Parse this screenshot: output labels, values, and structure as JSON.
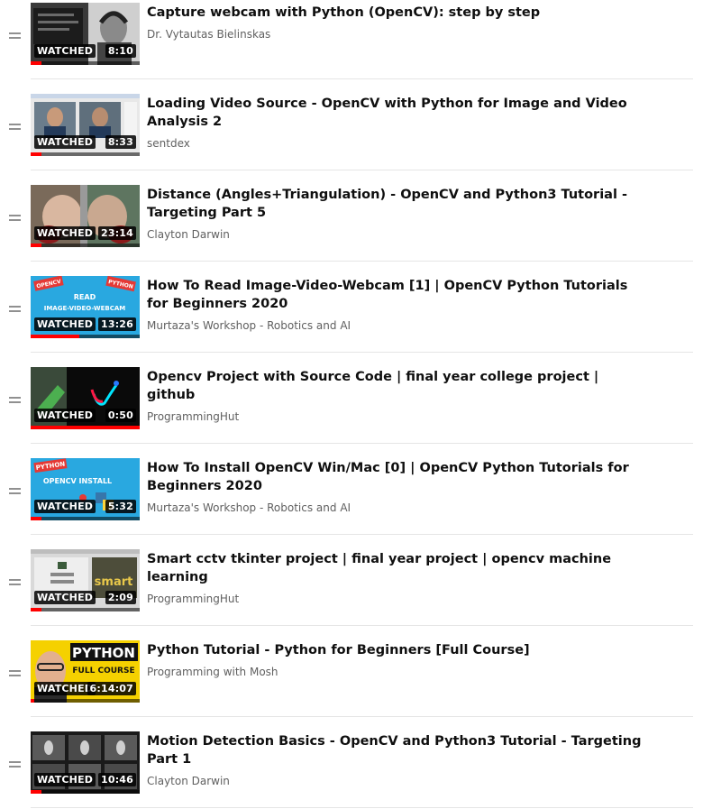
{
  "watched_label": "WATCHED",
  "progress_color": "#ff0000",
  "videos": [
    {
      "title": "Capture webcam with Python (OpenCV): step by step",
      "channel": "Dr. Vytautas Bielinskas",
      "duration": "8:10",
      "progress_fraction": 0.1,
      "thumb_style": "webcam-talk"
    },
    {
      "title": "Loading Video Source - OpenCV with Python for Image and Video Analysis 2",
      "channel": "sentdex",
      "duration": "8:33",
      "progress_fraction": 0.1,
      "thumb_style": "desktop-screens"
    },
    {
      "title": "Distance (Angles+Triangulation) - OpenCV and Python3 Tutorial - Targeting Part 5",
      "channel": "Clayton Darwin",
      "duration": "23:14",
      "progress_fraction": 0.1,
      "thumb_style": "hand-camera"
    },
    {
      "title": "How To Read Image-Video-Webcam [1] | OpenCV Python Tutorials for Beginners 2020",
      "channel": "Murtaza's Workshop - Robotics and AI",
      "duration": "13:26",
      "progress_fraction": 0.45,
      "thumb_style": "blue-tutorial-read",
      "thumb_text": [
        "OPENCV",
        "PYTHON",
        "READ",
        "IMAGE-VIDEO-WEBCAM"
      ]
    },
    {
      "title": "Opencv Project with Source Code | final year college project | github",
      "channel": "ProgrammingHut",
      "duration": "0:50",
      "progress_fraction": 1.0,
      "thumb_style": "dark-drawing"
    },
    {
      "title": "How To Install OpenCV Win/Mac [0] | OpenCV Python Tutorials for Beginners 2020",
      "channel": "Murtaza's Workshop - Robotics and AI",
      "duration": "5:32",
      "progress_fraction": 0.1,
      "thumb_style": "blue-tutorial-install",
      "thumb_text": [
        "PYTHON",
        "OPENCV INSTALL"
      ]
    },
    {
      "title": "Smart cctv tkinter project | final year project | opencv machine learning",
      "channel": "ProgrammingHut",
      "duration": "2:09",
      "progress_fraction": 0.1,
      "thumb_style": "smart-cctv",
      "thumb_text": [
        "smart"
      ]
    },
    {
      "title": "Python Tutorial - Python for Beginners [Full Course]",
      "channel": "Programming with Mosh",
      "duration": "6:14:07",
      "progress_fraction": 0.03,
      "thumb_style": "python-course",
      "thumb_text": [
        "PYTHON",
        "FULL COURSE"
      ]
    },
    {
      "title": "Motion Detection Basics - OpenCV and Python3 Tutorial - Targeting Part 1",
      "channel": "Clayton Darwin",
      "duration": "10:46",
      "progress_fraction": 0.1,
      "thumb_style": "motion-frames"
    }
  ]
}
